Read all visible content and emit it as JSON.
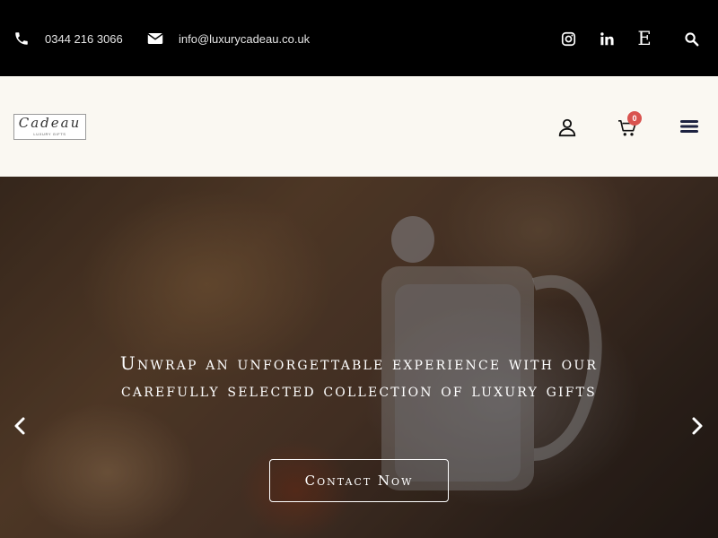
{
  "topbar": {
    "phone": "0344 216 3066",
    "email": "info@luxurycadeau.co.uk",
    "icons": [
      "phone-icon",
      "envelope-icon",
      "instagram-icon",
      "linkedin-icon",
      "etsy-icon",
      "search-icon"
    ]
  },
  "header": {
    "logo": {
      "brand": "Cadeau",
      "tagline": "LUXURY GIFTS"
    },
    "cart_count": "0",
    "icons": [
      "user-icon",
      "cart-icon",
      "menu-icon"
    ]
  },
  "hero": {
    "headline": "Unwrap an unforgettable experience with our carefully selected collection of luxury gifts",
    "cta_label": "Contact Now",
    "icons": [
      "chevron-left-icon",
      "chevron-right-icon"
    ]
  },
  "colors": {
    "topbar_bg": "#000000",
    "header_bg": "#faf8f2",
    "badge": "#d9534f",
    "text_light": "#ffffff"
  }
}
